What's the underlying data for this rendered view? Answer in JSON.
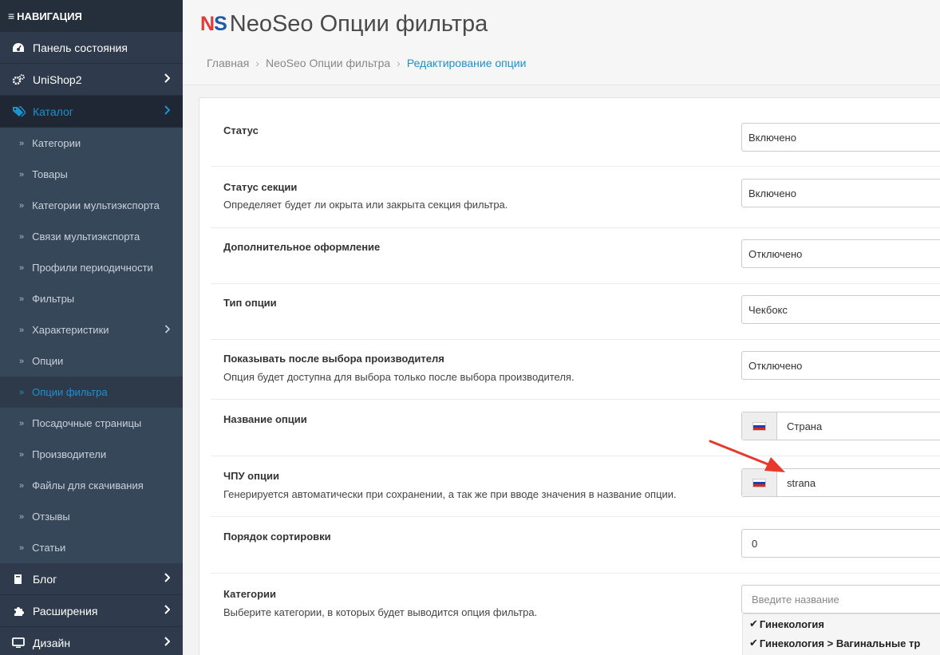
{
  "nav": {
    "header": "НАВИГАЦИЯ",
    "top_items": [
      {
        "label": "Панель состояния",
        "icon": "dashboard-icon"
      },
      {
        "label": "UniShop2",
        "icon": "gears-icon"
      },
      {
        "label": "Каталог",
        "icon": "tags-icon"
      }
    ],
    "catalog_sub": [
      "Категории",
      "Товары",
      "Категории мультиэкспорта",
      "Связи мультиэкспорта",
      "Профили периодичности",
      "Фильтры",
      "Характеристики",
      "Опции",
      "Опции фильтра",
      "Посадочные страницы",
      "Производители",
      "Файлы для скачивания",
      "Отзывы",
      "Статьи"
    ],
    "bottom_items": [
      {
        "label": "Блог",
        "icon": "book-icon"
      },
      {
        "label": "Расширения",
        "icon": "puzzle-icon"
      },
      {
        "label": "Дизайн",
        "icon": "monitor-icon"
      }
    ]
  },
  "header": {
    "logo": {
      "n": "N",
      "s": "S"
    },
    "title": "NeoSeo Опции фильтра",
    "breadcrumb": [
      "Главная",
      "NeoSeo Опции фильтра",
      "Редактирование опции"
    ]
  },
  "form": {
    "status": {
      "label": "Статус",
      "value": "Включено"
    },
    "section_status": {
      "label": "Статус секции",
      "help": "Определяет будет ли окрыта или закрыта секция фильтра.",
      "value": "Включено"
    },
    "extra_style": {
      "label": "Дополнительное оформление",
      "value": "Отключено"
    },
    "option_type": {
      "label": "Тип опции",
      "value": "Чекбокс"
    },
    "show_after_manufacturer": {
      "label": "Показывать после выбора производителя",
      "help": "Опция будет доступна для выбора только после выбора производителя.",
      "value": "Отключено"
    },
    "option_name": {
      "label": "Название опции",
      "value": "Страна"
    },
    "option_seo": {
      "label": "ЧПУ опции",
      "help": "Генерируется автоматически при сохранении, а так же при вводе значения в название опции.",
      "value": "strana"
    },
    "sort_order": {
      "label": "Порядок сортировки",
      "value": "0"
    },
    "categories": {
      "label": "Категории",
      "help": "Выберите категории, в которых будет выводится опция фильтра.",
      "placeholder": "Введите название",
      "items": [
        "Гинекология",
        "Гинекология  >  Вагинальные тр"
      ]
    }
  },
  "colors": {
    "accent": "#1e91cf",
    "sidebar": "#2f3b4c",
    "arrow": "#e8392d"
  }
}
